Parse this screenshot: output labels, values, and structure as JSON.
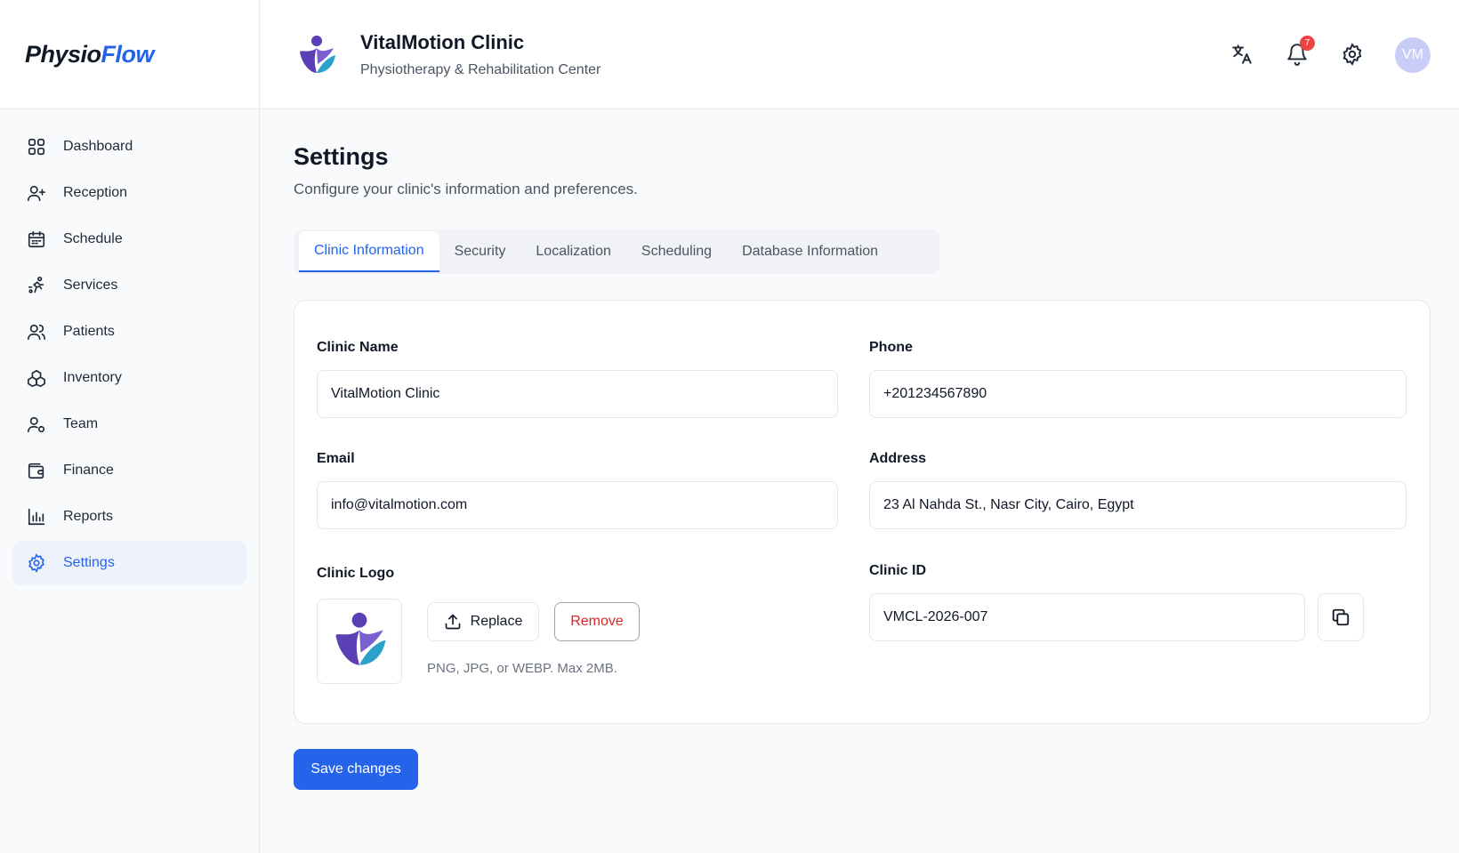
{
  "brand": {
    "part1": "Physio",
    "part2": "Flow"
  },
  "sidebar": {
    "items": [
      {
        "label": "Dashboard",
        "icon": "dashboard-grid-icon"
      },
      {
        "label": "Reception",
        "icon": "user-plus-icon"
      },
      {
        "label": "Schedule",
        "icon": "calendar-icon"
      },
      {
        "label": "Services",
        "icon": "running-person-icon"
      },
      {
        "label": "Patients",
        "icon": "users-icon"
      },
      {
        "label": "Inventory",
        "icon": "boxes-icon"
      },
      {
        "label": "Team",
        "icon": "user-gear-icon"
      },
      {
        "label": "Finance",
        "icon": "wallet-icon"
      },
      {
        "label": "Reports",
        "icon": "bar-chart-icon"
      },
      {
        "label": "Settings",
        "icon": "gear-icon",
        "active": true
      }
    ]
  },
  "header": {
    "clinic_name": "VitalMotion Clinic",
    "clinic_subtitle": "Physiotherapy & Rehabilitation Center",
    "notification_count": "7",
    "avatar_initials": "VM"
  },
  "page": {
    "title": "Settings",
    "subtitle": "Configure your clinic's information and preferences."
  },
  "tabs": [
    {
      "label": "Clinic Information",
      "active": true
    },
    {
      "label": "Security"
    },
    {
      "label": "Localization"
    },
    {
      "label": "Scheduling"
    },
    {
      "label": "Database Information"
    }
  ],
  "form": {
    "clinic_name_label": "Clinic Name",
    "clinic_name_value": "VitalMotion Clinic",
    "phone_label": "Phone",
    "phone_value": "+201234567890",
    "email_label": "Email",
    "email_value": "info@vitalmotion.com",
    "address_label": "Address",
    "address_value": "23 Al Nahda St., Nasr City, Cairo, Egypt",
    "logo_label": "Clinic Logo",
    "replace_label": "Replace",
    "remove_label": "Remove",
    "logo_hint": "PNG, JPG, or WEBP. Max 2MB.",
    "clinic_id_label": "Clinic ID",
    "clinic_id_value": "VMCL-2026-007"
  },
  "actions": {
    "save_label": "Save changes"
  },
  "colors": {
    "accent": "#2563eb",
    "danger": "#dc2626",
    "logo_purple": "#5b3fb5",
    "logo_teal": "#2aa1c9"
  }
}
